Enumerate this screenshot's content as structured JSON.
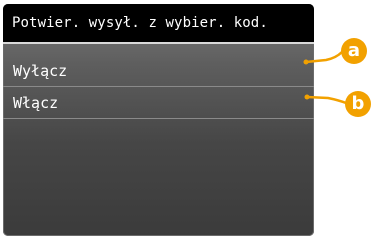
{
  "screen": {
    "title": "Potwier. wysył. z wybier. kod."
  },
  "menu": {
    "items": [
      {
        "label": "Wyłącz"
      },
      {
        "label": "Włącz"
      }
    ]
  },
  "callouts": [
    {
      "letter": "a"
    },
    {
      "letter": "b"
    }
  ],
  "colors": {
    "callout": "#f2a100",
    "title_bar": "#000000",
    "screen_top": "#7a7a7a",
    "screen_bottom": "#3b3b3b",
    "text": "#ffffff"
  }
}
